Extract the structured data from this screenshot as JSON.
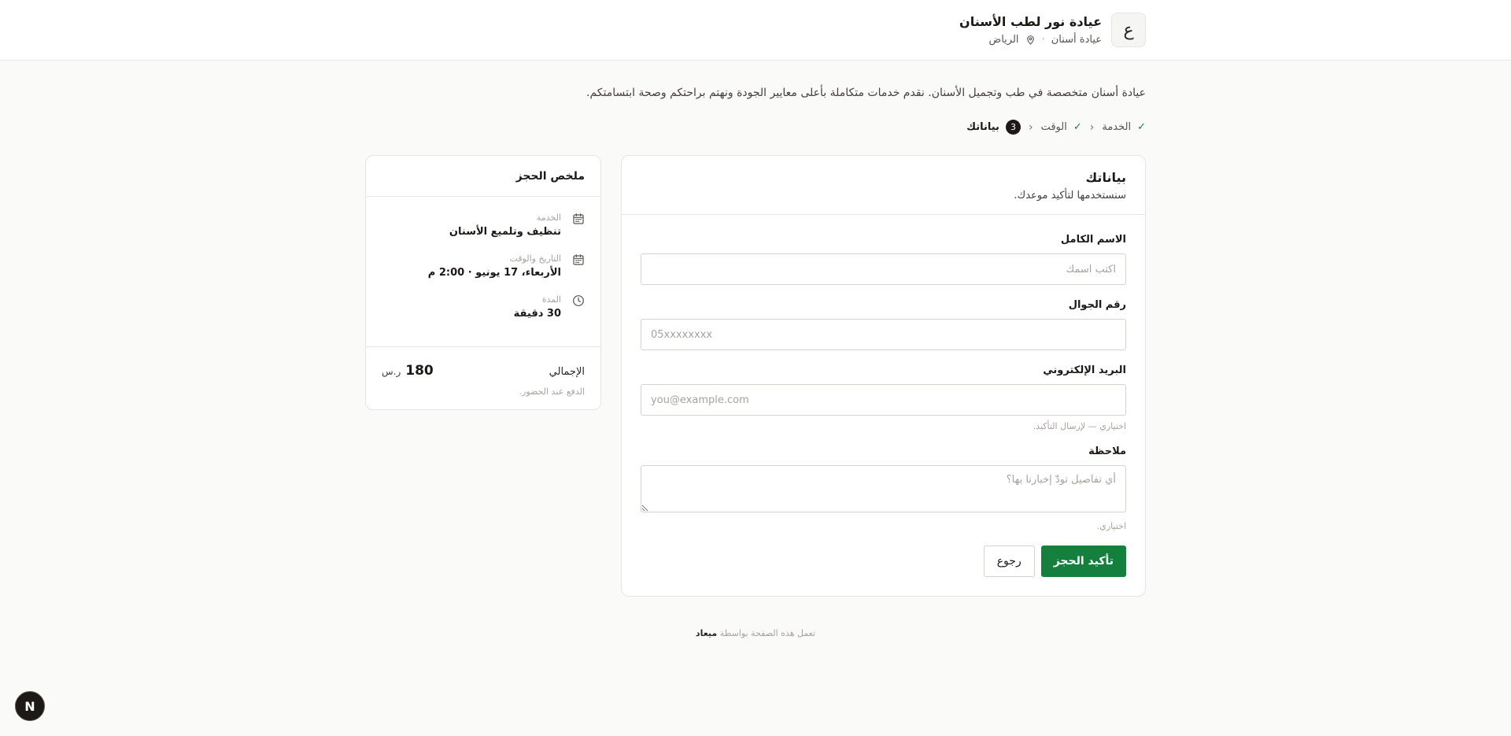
{
  "header": {
    "logo_letter": "ع",
    "clinic_name": "عيادة نور لطب الأسنان",
    "category": "عيادة أسنان",
    "separator": "·",
    "city": "الرياض"
  },
  "intro": "عيادة أسنان متخصصة في طب وتجميل الأسنان. نقدم خدمات متكاملة بأعلى معايير الجودة ونهتم براحتكم وصحة ابتسامتكم.",
  "steps": [
    {
      "label": "الخدمة",
      "state": "done"
    },
    {
      "label": "الوقت",
      "state": "done"
    },
    {
      "label": "بياناتك",
      "state": "active",
      "number": "3"
    }
  ],
  "form": {
    "title": "بياناتك",
    "subtitle": "سنستخدمها لتأكيد موعدك.",
    "name": {
      "label": "الاسم الكامل",
      "placeholder": "اكتب اسمك",
      "value": ""
    },
    "phone": {
      "label": "رقم الجوال",
      "placeholder": "05xxxxxxxx",
      "value": ""
    },
    "email": {
      "label": "البريد الإلكتروني",
      "placeholder": "you@example.com",
      "value": "",
      "hint": "اختياري — لإرسال التأكيد."
    },
    "note": {
      "label": "ملاحظة",
      "placeholder": "أي تفاصيل تودّ إخبارنا بها؟",
      "value": "",
      "hint": "اختياري."
    },
    "confirm_label": "تأكيد الحجز",
    "back_label": "رجوع"
  },
  "summary": {
    "title": "ملخص الحجز",
    "service_label": "الخدمة",
    "service_value": "تنظيف وتلميع الأسنان",
    "datetime_label": "التاريخ والوقت",
    "datetime_value": "الأربعاء، 17 يونيو · 2:00 م",
    "duration_label": "المدة",
    "duration_value": "30 دقيقة",
    "total_label": "الإجمالي",
    "total_amount": "180",
    "currency": "ر.س",
    "payment_note": "الدفع عند الحضور."
  },
  "footer": {
    "text": "تعمل هذه الصفحة بواسطة",
    "brand": "ميعاد"
  },
  "badge_letter": "N",
  "colors": {
    "primary": "#15803d",
    "background": "#fafaf9",
    "border": "#e7e5e4"
  }
}
